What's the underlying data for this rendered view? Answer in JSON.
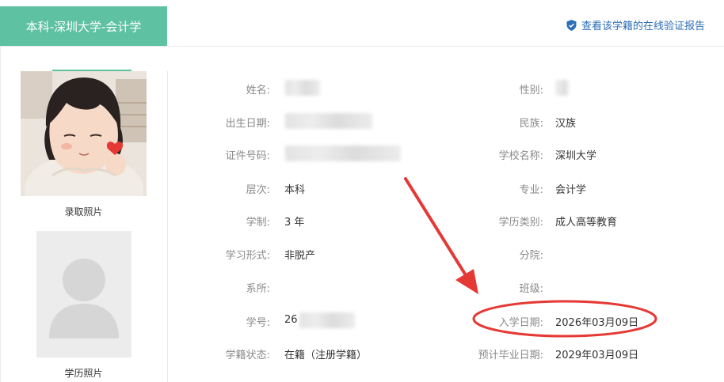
{
  "tab_title": "本科-深圳大学-会计学",
  "verify_link": "查看该学籍的在线验证报告",
  "photos": {
    "admission_caption": "录取照片",
    "education_caption": "学历照片"
  },
  "fields": {
    "name": {
      "label": "姓名:",
      "value": ""
    },
    "gender": {
      "label": "性别:",
      "value": ""
    },
    "birth_date": {
      "label": "出生日期:",
      "value": ""
    },
    "ethnicity": {
      "label": "民族:",
      "value": "汉族"
    },
    "id_number": {
      "label": "证件号码:",
      "value": ""
    },
    "school": {
      "label": "学校名称:",
      "value": "深圳大学"
    },
    "level": {
      "label": "层次:",
      "value": "本科"
    },
    "major": {
      "label": "专业:",
      "value": "会计学"
    },
    "duration": {
      "label": "学制:",
      "value": "3 年"
    },
    "edu_category": {
      "label": "学历类别:",
      "value": "成人高等教育"
    },
    "study_form": {
      "label": "学习形式:",
      "value": "非脱产"
    },
    "branch": {
      "label": "分院:",
      "value": ""
    },
    "department": {
      "label": "系所:",
      "value": ""
    },
    "class": {
      "label": "班级:",
      "value": ""
    },
    "student_id": {
      "label": "学号:",
      "value": "26"
    },
    "enroll_date": {
      "label": "入学日期:",
      "value": "2026年03月09日"
    },
    "status": {
      "label": "学籍状态:",
      "value": "在籍（注册学籍）"
    },
    "grad_date": {
      "label": "预计毕业日期:",
      "value": "2029年03月09日"
    }
  },
  "colors": {
    "accent": "#5ec2a2",
    "link": "#2c6fb7",
    "annotation": "#e53935"
  }
}
